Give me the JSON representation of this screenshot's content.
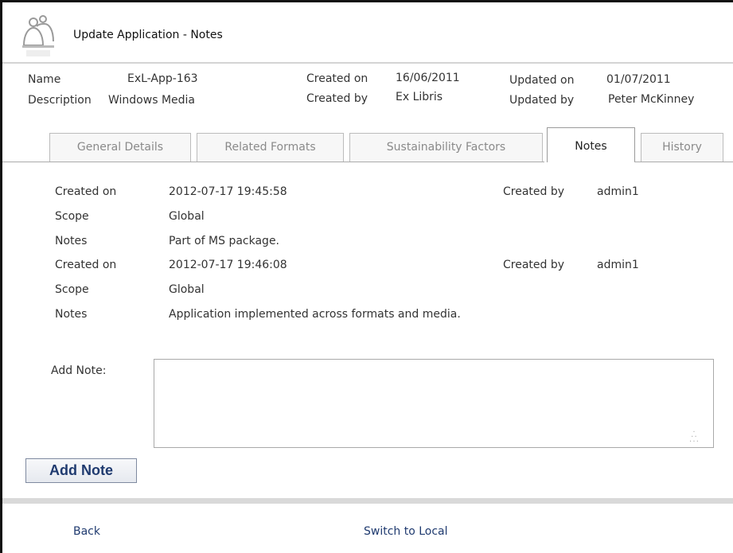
{
  "window": {
    "title": "Update Application - Notes"
  },
  "meta": {
    "name_label": "Name",
    "name_value": "ExL-App-163",
    "description_label": "Description",
    "description_value": "Windows Media",
    "created_on_label": "Created on",
    "created_on_value": "16/06/2011",
    "created_by_label": "Created by",
    "created_by_value": "Ex Libris",
    "updated_on_label": "Updated on",
    "updated_on_value": "01/07/2011",
    "updated_by_label": "Updated by",
    "updated_by_value": "Peter McKinney"
  },
  "tabs": [
    {
      "label": "General Details"
    },
    {
      "label": "Related Formats"
    },
    {
      "label": "Sustainability Factors"
    },
    {
      "label": "Notes"
    },
    {
      "label": "History"
    }
  ],
  "notes": [
    {
      "created_on_label": "Created on",
      "created_on": "2012-07-17 19:45:58",
      "created_by_label": "Created by",
      "created_by": "admin1",
      "scope_label": "Scope",
      "scope": "Global",
      "notes_label": "Notes",
      "text": "Part of MS package."
    },
    {
      "created_on_label": "Created on",
      "created_on": "2012-07-17 19:46:08",
      "created_by_label": "Created by",
      "created_by": "admin1",
      "scope_label": "Scope",
      "scope": "Global",
      "notes_label": "Notes",
      "text": "Application implemented across formats and media."
    }
  ],
  "add_note": {
    "label": "Add Note:",
    "value": "",
    "button_label": "Add Note"
  },
  "footer": {
    "back_label": "Back",
    "switch_label": "Switch to Local"
  }
}
